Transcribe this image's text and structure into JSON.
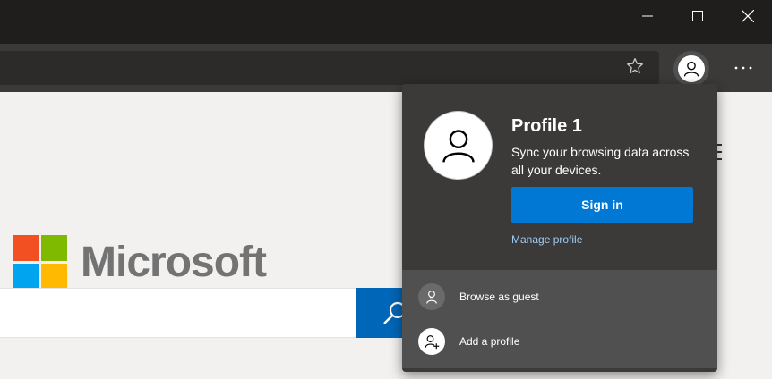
{
  "window": {
    "minimize_icon": "minimize-icon",
    "maximize_icon": "maximize-icon",
    "close_icon": "close-icon"
  },
  "toolbar": {
    "favorite_icon": "star-icon",
    "profile_icon": "person-icon",
    "more_icon": "ellipsis-icon"
  },
  "page": {
    "brand_text": "Microsoft",
    "logo_colors": [
      "#f25022",
      "#7fba00",
      "#00a4ef",
      "#ffb900"
    ]
  },
  "profile_menu": {
    "name": "Profile 1",
    "sync_text": "Sync your browsing data across all your devices.",
    "sign_in_label": "Sign in",
    "manage_link": "Manage profile",
    "items": [
      {
        "label": "Browse as guest",
        "icon": "guest-icon"
      },
      {
        "label": "Add a profile",
        "icon": "add-profile-icon"
      }
    ]
  },
  "colors": {
    "accent": "#0078d4",
    "link": "#9fcbf5",
    "popup_bg": "#3b3a39",
    "popup_footer_bg": "#505050"
  }
}
